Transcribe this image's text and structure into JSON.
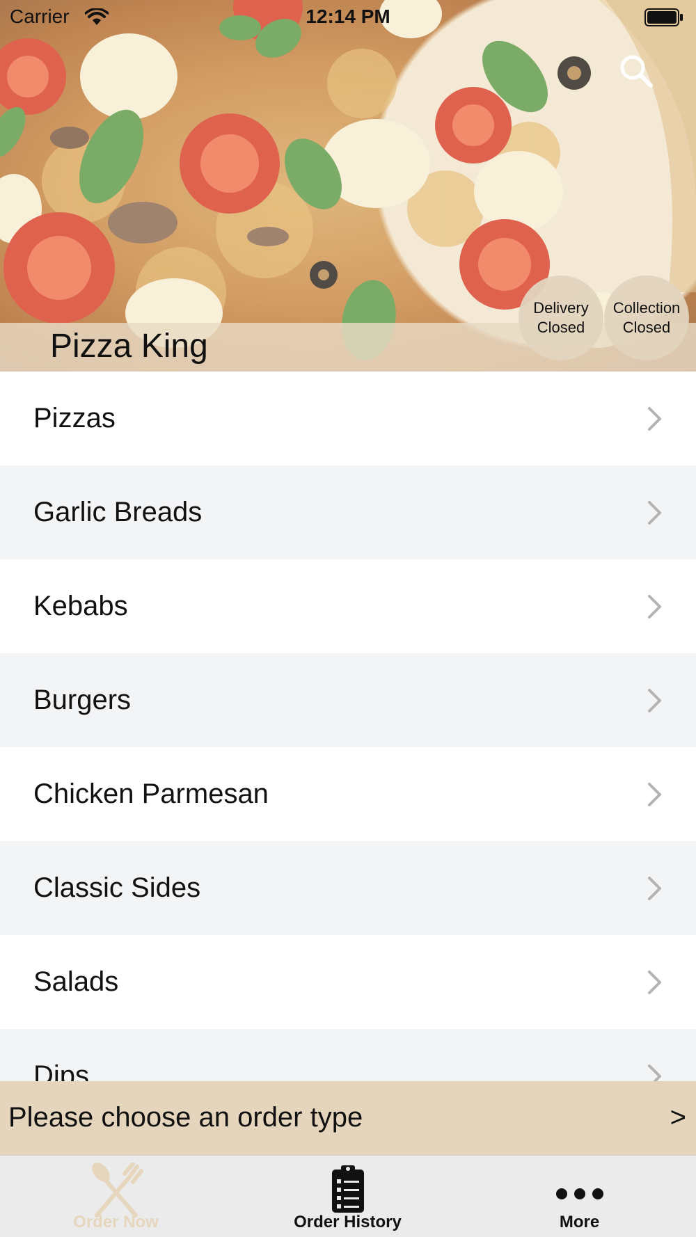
{
  "status_bar": {
    "carrier": "Carrier",
    "time": "12:14 PM"
  },
  "hero": {
    "restaurant_name": "Pizza King",
    "delivery_status": {
      "line1": "Delivery",
      "line2": "Closed"
    },
    "collection_status": {
      "line1": "Collection",
      "line2": "Closed"
    },
    "search_icon": "search-icon"
  },
  "menu": {
    "items": [
      {
        "label": "Pizzas"
      },
      {
        "label": "Garlic Breads"
      },
      {
        "label": "Kebabs"
      },
      {
        "label": "Burgers"
      },
      {
        "label": "Chicken Parmesan"
      },
      {
        "label": "Classic Sides"
      },
      {
        "label": "Salads"
      },
      {
        "label": "Dips"
      }
    ]
  },
  "order_type_bar": {
    "text": "Please choose an order type",
    "arrow": ">"
  },
  "tab_bar": {
    "tabs": [
      {
        "label": "Order Now",
        "icon": "fork-knife-icon",
        "active": true
      },
      {
        "label": "Order History",
        "icon": "clipboard-list-icon",
        "active": false
      },
      {
        "label": "More",
        "icon": "more-dots-icon",
        "active": false
      }
    ]
  },
  "colors": {
    "accent_beige": "#e5d5bc",
    "active_tab": "#e6d6bd",
    "row_alt": "#f3f4f6"
  }
}
